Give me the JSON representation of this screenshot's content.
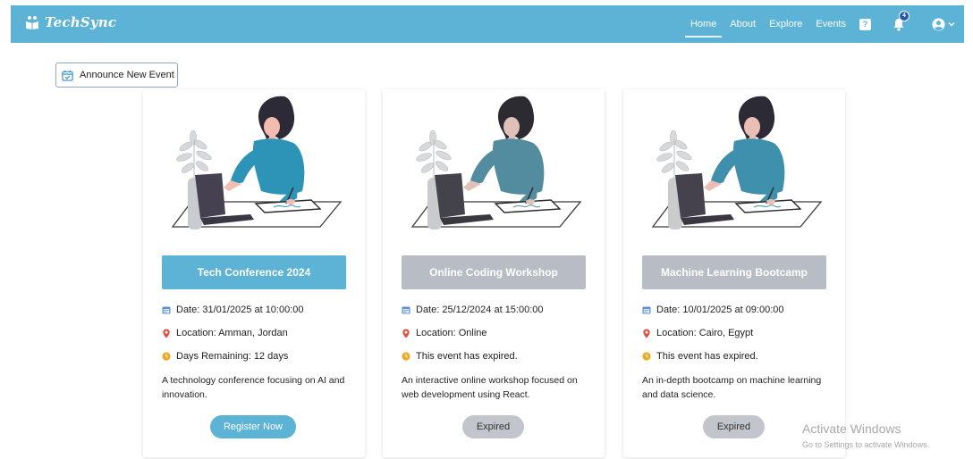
{
  "brand": {
    "name": "TechSync"
  },
  "nav": {
    "links": [
      "Home",
      "About",
      "Explore",
      "Events"
    ],
    "help_label": "?",
    "notification_count": "4"
  },
  "announce_label": "Announce New Event",
  "events": [
    {
      "title": "Tech Conference 2024",
      "date": "Date: 31/01/2025 at 10:00:00",
      "location": "Location: Amman, Jordan",
      "status": "Days Remaining: 12 days",
      "description": "A technology conference focusing on AI and innovation.",
      "button": "Register Now"
    },
    {
      "title": "Online Coding Workshop",
      "date": "Date: 25/12/2024 at 15:00:00",
      "location": "Location: Online",
      "status": "This event has expired.",
      "description": "An interactive online workshop focused on web development using React.",
      "button": "Expired"
    },
    {
      "title": "Machine Learning Bootcamp",
      "date": "Date: 10/01/2025 at 09:00:00",
      "location": "Location: Cairo, Egypt",
      "status": "This event has expired.",
      "description": "An in-depth bootcamp on machine learning and data science.",
      "button": "Expired"
    }
  ],
  "watermark": {
    "title": "Activate Windows",
    "subtitle": "Go to Settings to activate Windows."
  },
  "colors": {
    "accent": "#5cb3d6",
    "expired": "#b8bcc4",
    "calendar_icon": "#5b8fd1",
    "pin_icon": "#e0503e",
    "clock_icon": "#e7ad24"
  },
  "icons": [
    "book-icon",
    "calendar-check-icon",
    "question-icon",
    "bell-icon",
    "user-circle-icon",
    "chevron-down-icon",
    "calendar-icon",
    "pin-icon",
    "clock-icon"
  ]
}
